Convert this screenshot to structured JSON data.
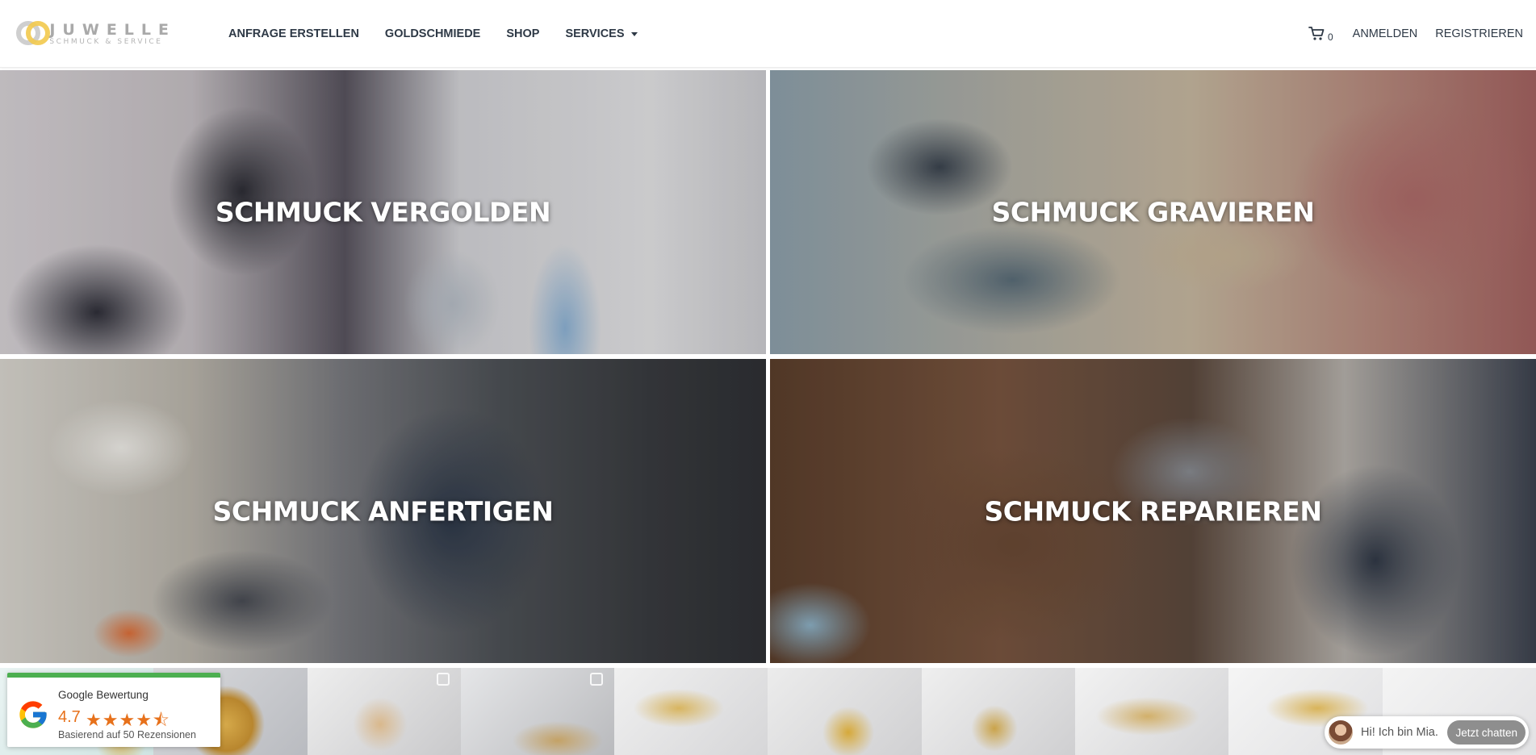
{
  "header": {
    "logo": {
      "name": "JUWELLE",
      "tagline": "SCHMUCK & SERVICE"
    },
    "nav": [
      {
        "label": "ANFRAGE ERSTELLEN"
      },
      {
        "label": "GOLDSCHMIEDE"
      },
      {
        "label": "SHOP"
      },
      {
        "label": "SERVICES"
      }
    ],
    "cart_count": "0",
    "login_label": "ANMELDEN",
    "register_label": "REGISTRIEREN"
  },
  "tiles": [
    {
      "label": "SCHMUCK VERGOLDEN"
    },
    {
      "label": "SCHMUCK GRAVIEREN"
    },
    {
      "label": "SCHMUCK ANFERTIGEN"
    },
    {
      "label": "SCHMUCK REPARIEREN"
    }
  ],
  "google_badge": {
    "title": "Google Bewertung",
    "score": "4.7",
    "rating_fraction": 0.94,
    "subtitle": "Basierend auf 50 Rezensionen"
  },
  "chat": {
    "greeting": "Hi! Ich bin Mia.",
    "button": "Jetzt chatten"
  },
  "colors": {
    "nav_text": "#2e3946",
    "google_green": "#4caf50",
    "star_orange": "#e7711b"
  },
  "icons": [
    "cart-icon",
    "chevron-down-icon",
    "google-logo-icon",
    "instagram-icon"
  ]
}
